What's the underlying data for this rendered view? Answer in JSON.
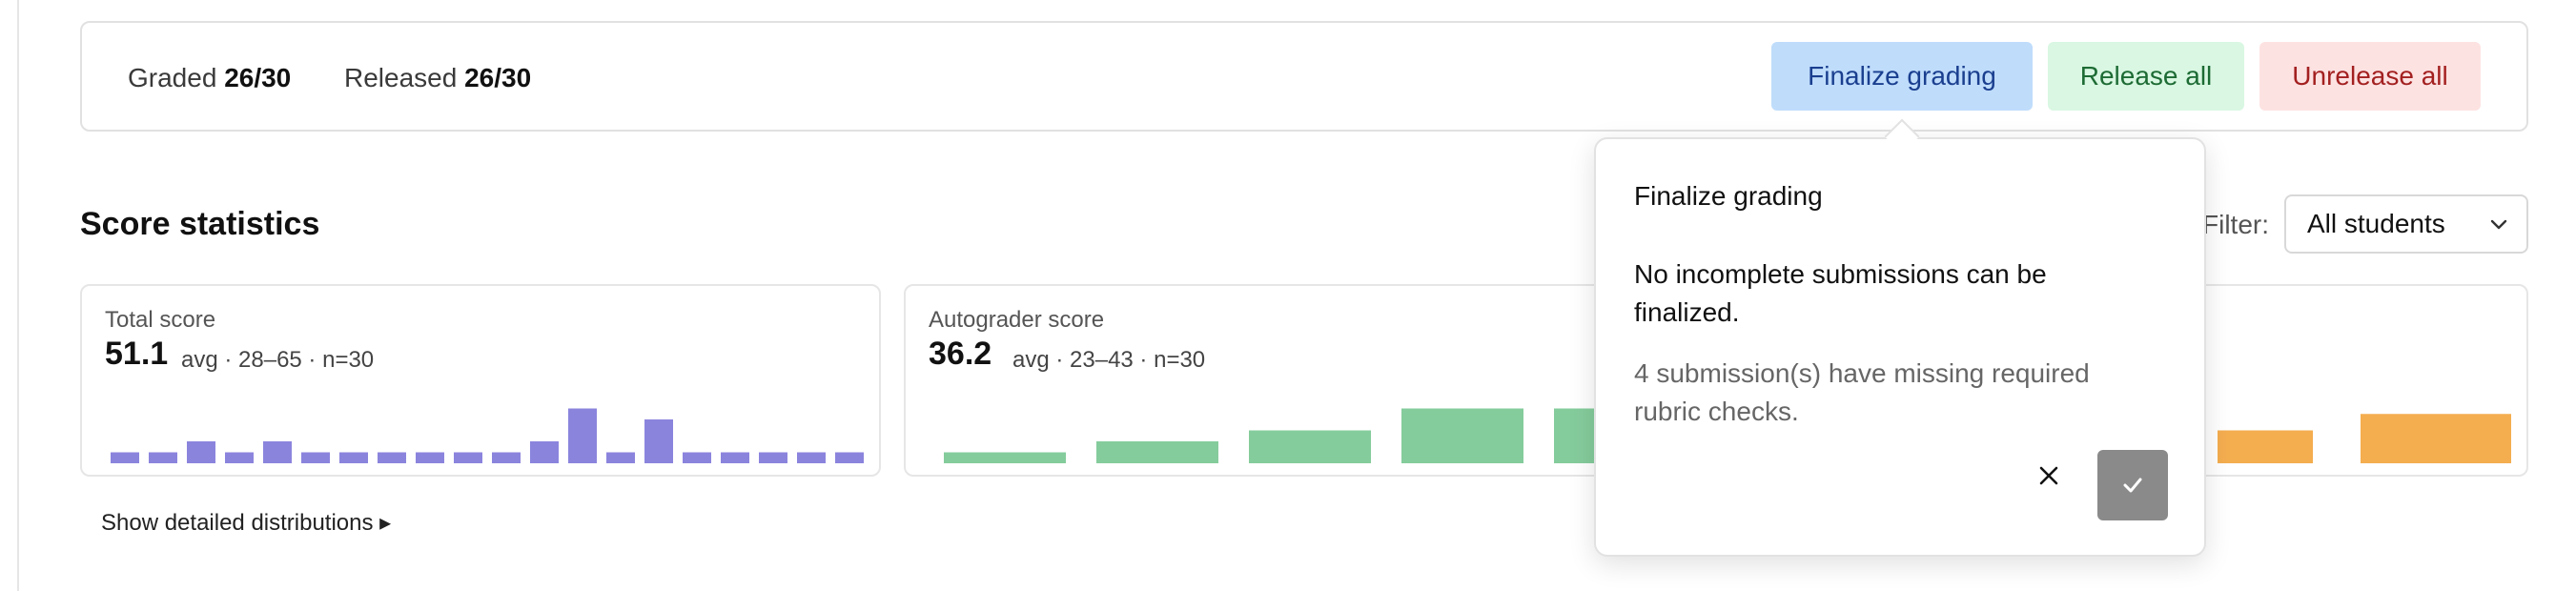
{
  "grading_bar": {
    "graded_label": "Graded",
    "graded_value": "26/30",
    "released_label": "Released",
    "released_value": "26/30",
    "finalize_button": "Finalize grading",
    "release_all_button": "Release all",
    "unrelease_all_button": "Unrelease all"
  },
  "score_statistics": {
    "title": "Score statistics",
    "filter_label": "Filter:",
    "filter_value": "All students",
    "show_details": "Show detailed distributions ▸"
  },
  "cards": {
    "total": {
      "title": "Total score",
      "avg": "51.1",
      "meta": "avg · 28–65 · n=30",
      "bar_color": "#8b84dd",
      "histogram": [
        1,
        1,
        2,
        1,
        2,
        1,
        1,
        1,
        1,
        1,
        1,
        2,
        5,
        1,
        4,
        1,
        1,
        1,
        1,
        1
      ]
    },
    "autograder": {
      "title": "Autograder score",
      "avg": "36.2",
      "meta": "avg · 23–43 · n=30",
      "green_color": "#85cc9c",
      "orange_color": "#f4ad4f",
      "histogram_visible_green": [
        1,
        2,
        3,
        5,
        5
      ],
      "histogram_visible_orange": [
        3,
        4.5
      ]
    }
  },
  "popover": {
    "title": "Finalize grading",
    "message": "No incomplete submissions can be finalized.",
    "warning": "4 submission(s) have missing required rubric checks.",
    "cancel_icon": "close-icon",
    "confirm_icon": "check-icon"
  }
}
